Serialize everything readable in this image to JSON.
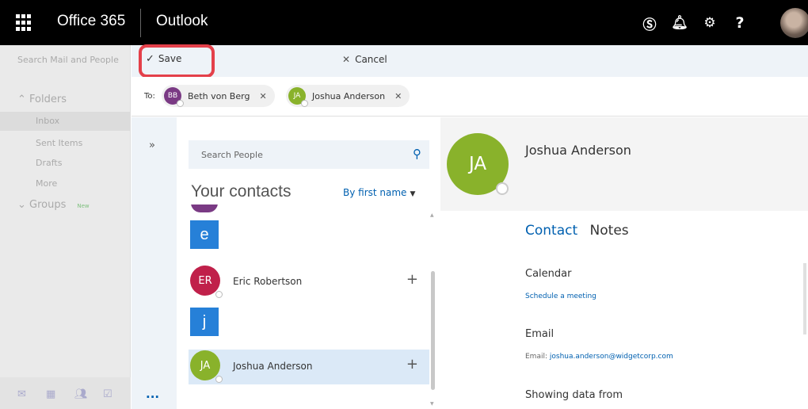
{
  "topbar": {
    "brand": "Office 365",
    "app": "Outlook",
    "icons": [
      "skype-icon",
      "bell-icon",
      "gear-icon",
      "help-icon"
    ]
  },
  "leftnav": {
    "search_placeholder": "Search Mail and People",
    "folders_label": "Folders",
    "items": [
      "Inbox",
      "Sent Items",
      "Drafts",
      "More"
    ],
    "groups_label": "Groups",
    "groups_new": "New"
  },
  "cmdbar": {
    "save_label": "Save",
    "cancel_label": "Cancel"
  },
  "to": {
    "label": "To:",
    "recipients": [
      {
        "initials": "BB",
        "name": "Beth von Berg",
        "color": "#7a3a84"
      },
      {
        "initials": "JA",
        "name": "Joshua Anderson",
        "color": "#89b22b"
      }
    ]
  },
  "people": {
    "search_placeholder": "Search People",
    "title": "Your contacts",
    "sort_label": "By first name",
    "letters": [
      "e",
      "j"
    ],
    "contacts": [
      {
        "initials": "ER",
        "name": "Eric Robertson",
        "color": "#c0204a"
      },
      {
        "initials": "JA",
        "name": "Joshua Anderson",
        "color": "#89b22b"
      }
    ]
  },
  "detail": {
    "initials": "JA",
    "name": "Joshua Anderson",
    "tabs": [
      "Contact",
      "Notes"
    ],
    "calendar_heading": "Calendar",
    "calendar_link": "Schedule a meeting",
    "email_heading": "Email",
    "email_label": "Email:",
    "email_value": "joshua.anderson@widgetcorp.com",
    "showing_heading": "Showing data from"
  },
  "colors": {
    "accent": "#0060b0",
    "highlight": "#e4404a"
  }
}
